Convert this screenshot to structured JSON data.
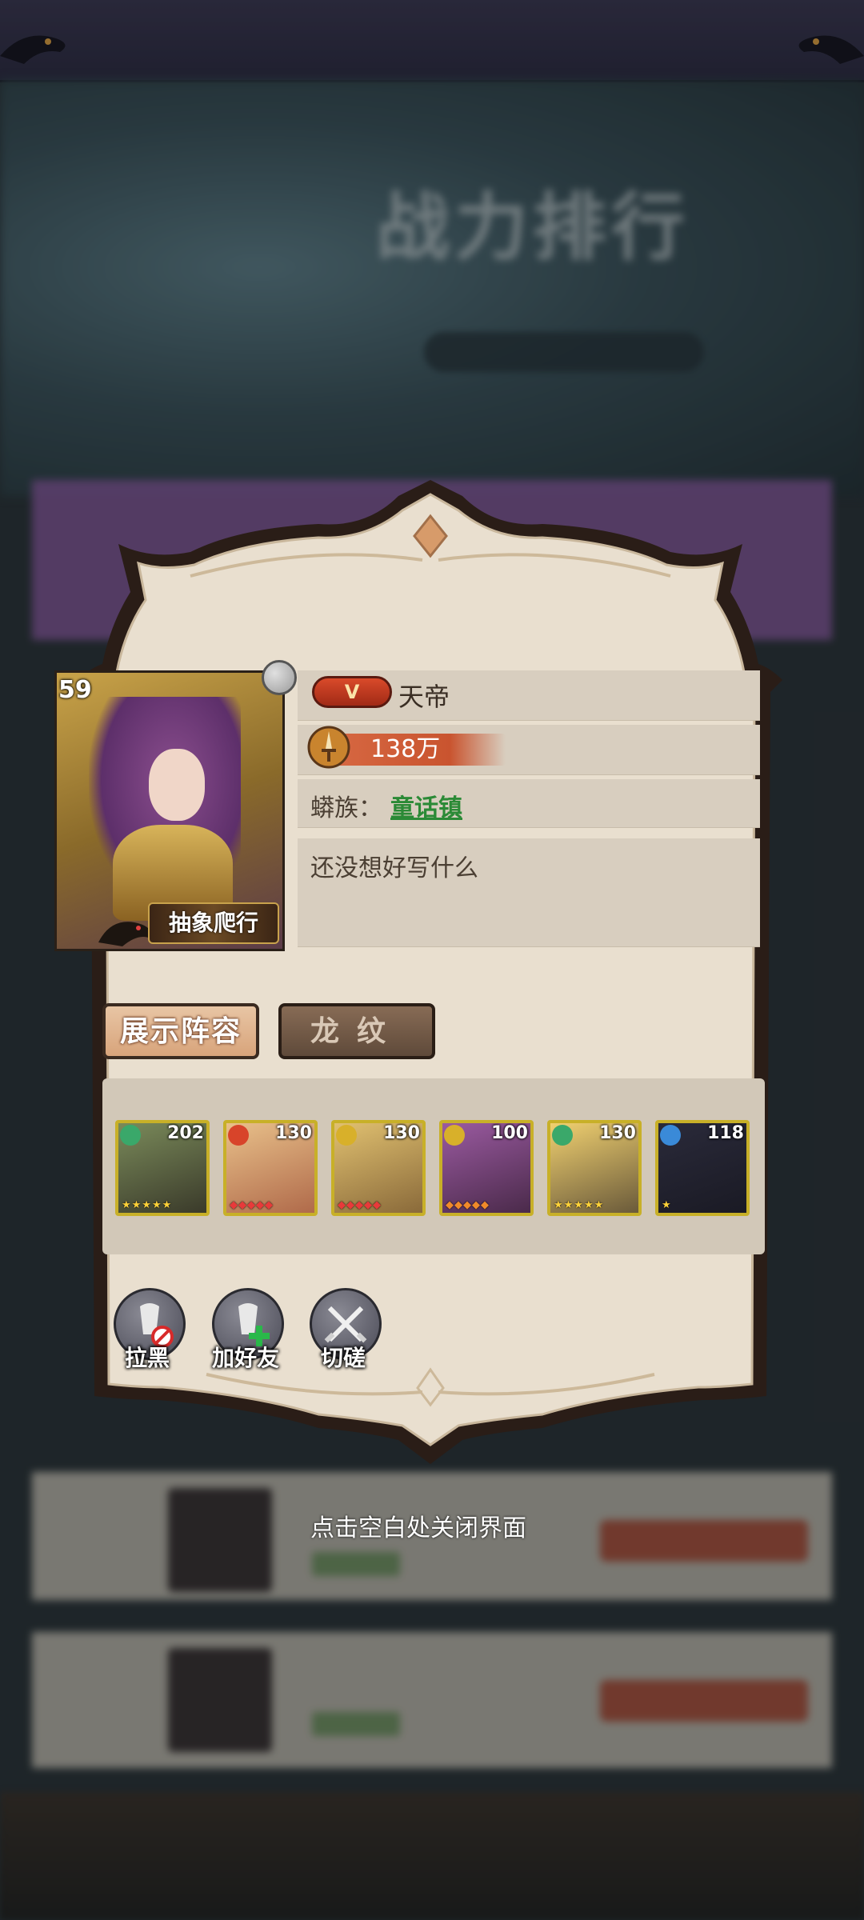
{
  "background": {
    "title": "战力排行"
  },
  "profile": {
    "level": "59",
    "avatar_name": "抽象爬行",
    "vip_label": "V",
    "title": "天帝",
    "power": "138万",
    "guild_label": "蟒族：",
    "guild_name": "童话镇",
    "signature": "还没想好写什么"
  },
  "tabs": [
    {
      "label": "展示阵容",
      "active": true
    },
    {
      "label": "龙纹",
      "active": false
    }
  ],
  "team": [
    {
      "level": "202",
      "element": "wind",
      "color": "#3aa86a"
    },
    {
      "level": "130",
      "element": "fire",
      "color": "#d8442a"
    },
    {
      "level": "130",
      "element": "light",
      "color": "#d8b02a"
    },
    {
      "level": "100",
      "element": "light",
      "color": "#d8b02a"
    },
    {
      "level": "130",
      "element": "wind",
      "color": "#3aa86a"
    },
    {
      "level": "118",
      "element": "water",
      "color": "#3a8ad8"
    }
  ],
  "actions": [
    {
      "label": "拉黑",
      "icon": "block-icon"
    },
    {
      "label": "加好友",
      "icon": "add-friend-icon"
    },
    {
      "label": "切磋",
      "icon": "crossed-swords-icon"
    }
  ],
  "close_hint": "点击空白处关闭界面"
}
